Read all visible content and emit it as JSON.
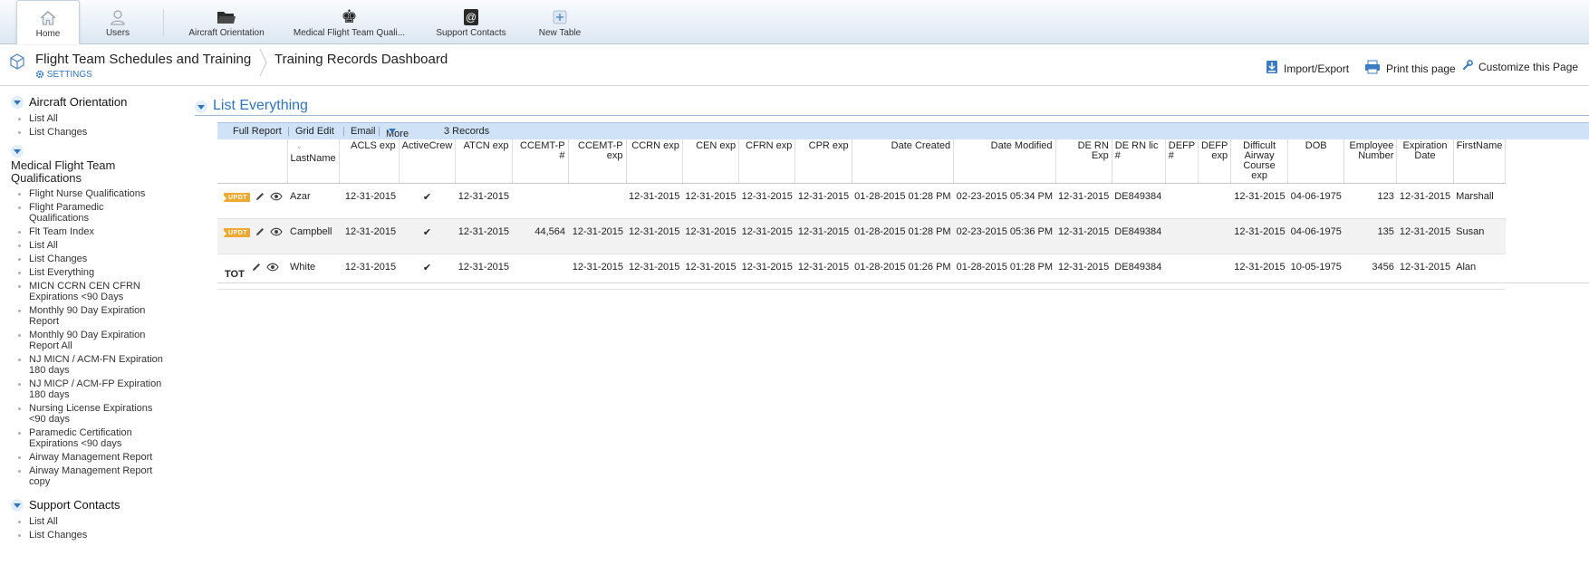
{
  "nav": {
    "tabs": [
      {
        "label": "Home",
        "icon": "home-icon"
      },
      {
        "label": "Users",
        "icon": "user-icon"
      },
      {
        "label": "Aircraft Orientation",
        "icon": "folder-icon"
      },
      {
        "label": "Medical Flight Team Quali...",
        "icon": "chess-king-icon"
      },
      {
        "label": "Support Contacts",
        "icon": "at-sign-icon"
      },
      {
        "label": "New Table",
        "icon": "plus-icon"
      }
    ]
  },
  "header": {
    "app_title": "Flight Team Schedules and Training",
    "settings_label": "SETTINGS",
    "breadcrumb": "Training Records Dashboard",
    "import_export": "Import/Export",
    "print": "Print this page",
    "customize": "Customize this Page"
  },
  "sidebar": {
    "sections": [
      {
        "title": "Aircraft Orientation",
        "items": [
          "List All",
          "List Changes"
        ]
      },
      {
        "title": "Medical Flight Team Qualifications",
        "items": [
          "Flight Nurse Qualifications",
          "Flight Paramedic Qualifications",
          "Flt Team Index",
          "List All",
          "List Changes",
          "List Everything",
          "MICN CCRN CEN CFRN Expirations <90 Days",
          "Monthly 90 Day Expiration Report",
          "Monthly 90 Day Expiration Report All",
          "NJ MICN / ACM-FN Expiration 180 days",
          "NJ MICP / ACM-FP Expiration 180 days",
          "Nursing License Expirations <90 days",
          "Paramedic Certification Expirations <90 days",
          "Airway Management Report",
          "Airway Management Report copy"
        ]
      },
      {
        "title": "Support Contacts",
        "items": [
          "List All",
          "List Changes"
        ]
      }
    ]
  },
  "list": {
    "title": "List Everything",
    "toolbar": {
      "full_report": "Full Report",
      "grid_edit": "Grid Edit",
      "email": "Email",
      "more": "More",
      "records": "3 Records"
    },
    "total_label": "TOT",
    "updt_badge": "UPDT",
    "columns": [
      "LastName",
      "ACLS exp",
      "ActiveCrew",
      "ATCN exp",
      "CCEMT-P #",
      "CCEMT-P exp",
      "CCRN exp",
      "CEN exp",
      "CFRN exp",
      "CPR exp",
      "Date Created",
      "Date Modified",
      "DE RN Exp",
      "DE RN lic #",
      "DEFP #",
      "DEFP exp",
      "Difficult Airway Course exp",
      "DOB",
      "Employee Number",
      "Expiration Date",
      "FirstName"
    ],
    "rows": [
      {
        "updt": true,
        "cells": [
          "Azar",
          "12-31-2015",
          "✔",
          "12-31-2015",
          "",
          "",
          "12-31-2015",
          "12-31-2015",
          "12-31-2015",
          "12-31-2015",
          "01-28-2015 01:28 PM",
          "02-23-2015 05:34 PM",
          "12-31-2015",
          "DE849384",
          "",
          "",
          "12-31-2015",
          "04-06-1975",
          "123",
          "12-31-2015",
          "Marshall"
        ]
      },
      {
        "updt": true,
        "cells": [
          "Campbell",
          "12-31-2015",
          "✔",
          "12-31-2015",
          "44,564",
          "12-31-2015",
          "12-31-2015",
          "12-31-2015",
          "12-31-2015",
          "12-31-2015",
          "01-28-2015 01:28 PM",
          "02-23-2015 05:36 PM",
          "12-31-2015",
          "DE849384",
          "",
          "",
          "12-31-2015",
          "04-06-1975",
          "135",
          "12-31-2015",
          "Susan"
        ]
      },
      {
        "updt": false,
        "cells": [
          "White",
          "12-31-2015",
          "✔",
          "12-31-2015",
          "",
          "12-31-2015",
          "12-31-2015",
          "12-31-2015",
          "12-31-2015",
          "12-31-2015",
          "01-28-2015 01:26 PM",
          "01-28-2015 01:28 PM",
          "12-31-2015",
          "DE849384",
          "",
          "",
          "12-31-2015",
          "10-05-1975",
          "3456",
          "12-31-2015",
          "Alan"
        ]
      }
    ]
  }
}
